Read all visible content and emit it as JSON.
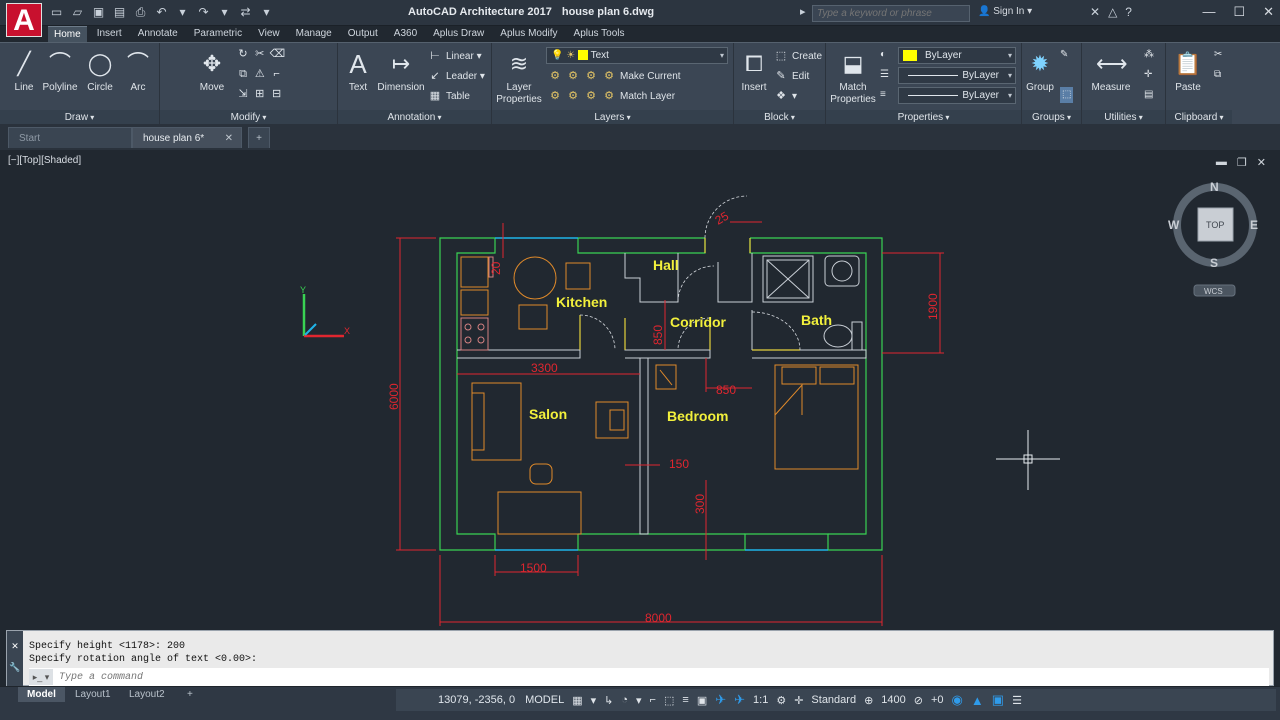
{
  "app": {
    "title": "AutoCAD Architecture 2017",
    "file": "house plan 6.dwg",
    "logo_letter": "A"
  },
  "search": {
    "placeholder": "Type a keyword or phrase"
  },
  "signin": "Sign In",
  "ribbon_tabs": [
    "Home",
    "Insert",
    "Annotate",
    "Parametric",
    "View",
    "Manage",
    "Output",
    "A360",
    "Aplus Draw",
    "Aplus Modify",
    "Aplus Tools"
  ],
  "active_tab": "Home",
  "ribbon": {
    "draw": {
      "title": "Draw",
      "tools": [
        "Line",
        "Polyline",
        "Circle",
        "Arc"
      ]
    },
    "modify": {
      "title": "Modify",
      "move": "Move"
    },
    "annotation": {
      "title": "Annotation",
      "text": "Text",
      "dimension": "Dimension",
      "linear": "Linear",
      "leader": "Leader",
      "table": "Table"
    },
    "layers": {
      "title": "Layers",
      "layer_properties": "Layer Properties",
      "current_layer": "Text",
      "make_current": "Make Current",
      "match_layer": "Match Layer"
    },
    "block": {
      "title": "Block",
      "insert": "Insert",
      "create": "Create",
      "edit": "Edit"
    },
    "properties": {
      "title": "Properties",
      "match_properties": "Match Properties",
      "color": "ByLayer",
      "linetype": "ByLayer",
      "lineweight": "ByLayer"
    },
    "groups": {
      "title": "Groups",
      "group": "Group"
    },
    "utilities": {
      "title": "Utilities",
      "measure": "Measure"
    },
    "clipboard": {
      "title": "Clipboard",
      "paste": "Paste"
    }
  },
  "file_tabs": [
    "Start",
    "house plan 6*"
  ],
  "viewport": {
    "label": "[−][Top][Shaded]"
  },
  "viewcube": {
    "n": "N",
    "s": "S",
    "e": "E",
    "w": "W",
    "top": "TOP",
    "wcs": "WCS"
  },
  "ucs": {
    "y": "Y",
    "x": "X"
  },
  "drawing": {
    "rooms": [
      "Hall",
      "Kitchen",
      "Corridor",
      "Bath",
      "Salon",
      "Bedroom"
    ],
    "dimensions": [
      "25",
      "20",
      "1900",
      "850",
      "3300",
      "6000",
      "850",
      "150",
      "300",
      "1500",
      "8000"
    ]
  },
  "command": {
    "history": [
      "Specify height <1178>: 200",
      "Specify rotation angle of text <0.00>:"
    ],
    "placeholder": "Type a command"
  },
  "layout_tabs": [
    "Model",
    "Layout1",
    "Layout2"
  ],
  "status": {
    "coords": "13079, -2356, 0",
    "model": "MODEL",
    "scale": "1:1",
    "style": "Standard",
    "value": "1400",
    "plus": "+0"
  }
}
